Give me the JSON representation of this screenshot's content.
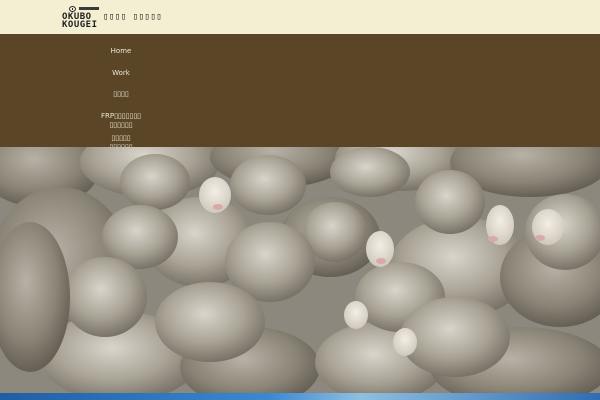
{
  "header": {
    "logo_line1": "OKUBO",
    "logo_line2": "KOUGEI",
    "site_name": "▯▯▯▯ ▯▯▯▯▯"
  },
  "nav": {
    "items": [
      {
        "label": "Home"
      },
      {
        "label": "Work"
      },
      {
        "label": "▯▯▯▯"
      },
      {
        "label": "FRP▯▯▯▯▯▯▯",
        "sub": "▯▯▯▯▯▯"
      },
      {
        "label": "▯▯▯▯▯",
        "sub": "▯▯▯▯▯▯"
      }
    ]
  },
  "hero": {
    "image": "flock-of-sheep-photo"
  },
  "colors": {
    "header_bg": "#f4efd2",
    "nav_bg": "#5a4626",
    "nav_text": "#efe8d6"
  }
}
